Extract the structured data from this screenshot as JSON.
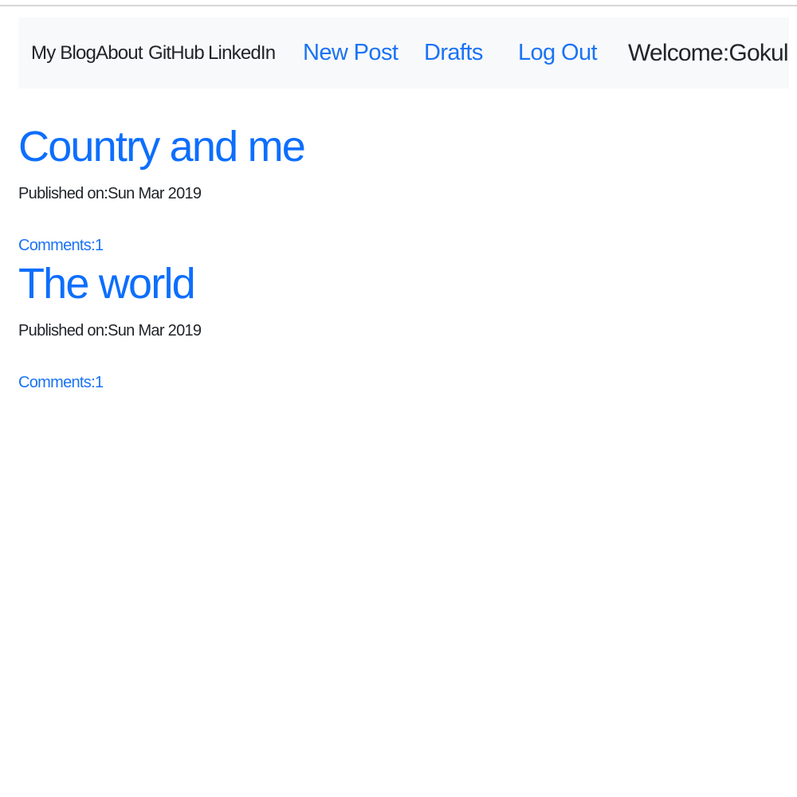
{
  "navbar": {
    "brand": "My Blog",
    "links": [
      "About",
      "GitHub",
      "LinkedIn"
    ],
    "actions": [
      "New Post",
      "Drafts",
      "Log Out"
    ],
    "welcome": "Welcome:Gokul"
  },
  "posts": [
    {
      "title": "Country and me",
      "published": "Published on:Sun Mar 2019",
      "comments": "Comments:1"
    },
    {
      "title": "The world",
      "published": "Published on:Sun Mar 2019",
      "comments": "Comments:1"
    }
  ],
  "colors": {
    "accent": "#0d6efd",
    "nav_background": "#f8f9fa",
    "text": "#212529"
  }
}
